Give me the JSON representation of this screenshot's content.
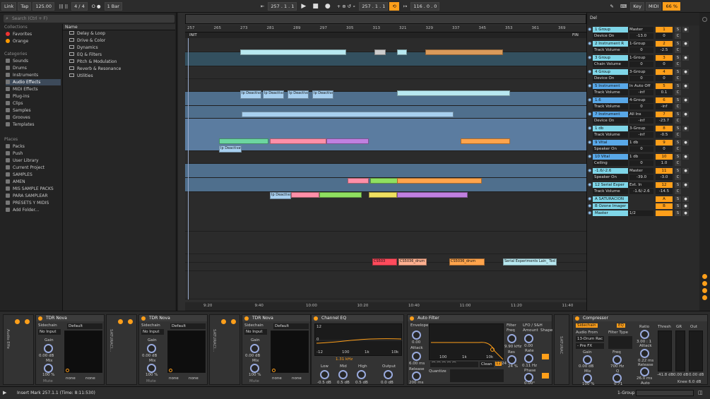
{
  "topbar": {
    "link": "Link",
    "tap": "Tap",
    "tempo": "125.00",
    "time_sig": "4 / 4",
    "metro": "O ●",
    "quant": "1 Bar",
    "pos": "257 . 1 . 1",
    "pos2": "257 . 1 . 1",
    "loop_len": "116 . 0 . 0",
    "key": "Key",
    "midi": "MIDI",
    "cpu": "66 %"
  },
  "browser": {
    "search_placeholder": "Search (Ctrl + F)",
    "collections_title": "Collections",
    "collections": [
      "Favorites",
      "Orange"
    ],
    "categories_title": "Categories",
    "categories": [
      "Sounds",
      "Drums",
      "Instruments",
      "Audio Effects",
      "MIDI Effects",
      "Plug-ins",
      "Clips",
      "Samples",
      "Grooves",
      "Templates"
    ],
    "places_title": "Places",
    "places": [
      "Packs",
      "Push",
      "User Library",
      "Current Project",
      "SAMPLES",
      "AMEN",
      "MIS SAMPLE PACKS",
      "PARA SAMPLEAR",
      "PRESETS Y MIDIS",
      "Add Folder..."
    ],
    "name_header": "Name",
    "files": [
      "Delay & Loop",
      "Drive & Color",
      "Dynamics",
      "EQ & Filters",
      "Pitch & Modulation",
      "Reverb & Resonance",
      "Utilities"
    ]
  },
  "arrangement": {
    "bars": [
      "257",
      "265",
      "273",
      "281",
      "289",
      "297",
      "305",
      "313",
      "321",
      "329",
      "337",
      "345",
      "353",
      "361",
      "369"
    ],
    "init": "INIT",
    "fin": "FIN",
    "times": [
      "9:20",
      "9:40",
      "10:00",
      "10:20",
      "10:40",
      "11:00",
      "11:20",
      "11:40"
    ],
    "clip_deact": "Ip Deactivat",
    "clip_cs": "CS5036_drum",
    "clip_serial": "Serial Experiments Lain_ Tod"
  },
  "mixer": {
    "header": "Del",
    "tracks": [
      {
        "name": "1 Group",
        "route": "Master",
        "num": "1",
        "vol": "0",
        "color": "#7fd6e8",
        "sub": "Device On",
        "subval": "-13.0"
      },
      {
        "name": "2 Instrument R",
        "route": "1-Group",
        "num": "2",
        "vol": "-2.5",
        "color": "#7fd6e8",
        "sub": "Track Volume",
        "subval": "0"
      },
      {
        "name": "3 Group",
        "route": "1-Group",
        "num": "3",
        "vol": "0",
        "color": "#7fd6e8",
        "sub": "Chain Volume",
        "subval": "0"
      },
      {
        "name": "4 Group",
        "route": "3-Group",
        "num": "4",
        "vol": "0",
        "color": "#7fd6e8",
        "sub": "Device On",
        "subval": "0"
      },
      {
        "name": "5 Instrument",
        "route": "In Auto Off",
        "num": "5",
        "vol": "0.1",
        "color": "#59a8e8",
        "sub": "Track Volume",
        "subval": "-inf"
      },
      {
        "name": "1.6",
        "route": "4-Group",
        "num": "6",
        "vol": "-inf",
        "color": "#59a8e8",
        "sub": "Track Volume",
        "subval": "0"
      },
      {
        "name": "7 Instrument",
        "route": "All Ins",
        "num": "7",
        "vol": "-23.7",
        "color": "#59a8e8",
        "sub": "Device On",
        "subval": "-inf"
      },
      {
        "name": "1 db",
        "route": "3-Group",
        "num": "8",
        "vol": "-0.5",
        "color": "#7fd6e8",
        "sub": "Track Volume",
        "subval": "-inf"
      },
      {
        "name": "9 Vital",
        "route": "1 db",
        "num": "9",
        "vol": "0",
        "color": "#59a8e8",
        "sub": "Speaker On",
        "subval": "0"
      },
      {
        "name": "10 Vital",
        "route": "1 db",
        "num": "10",
        "vol": "1.0",
        "color": "#59a8e8",
        "sub": "Ceiling",
        "subval": "0"
      },
      {
        "name": "-1.6/-2.6",
        "route": "Master",
        "num": "11",
        "vol": "-3.0",
        "color": "#7fd6e8",
        "sub": "Speaker On",
        "subval": "-39.0"
      },
      {
        "name": "12 Serial Exper",
        "route": "Ext. In",
        "num": "12",
        "vol": "-14.5",
        "color": "#7fd6e8",
        "sub": "Track Volume",
        "subval": "-1.6/-2.6"
      },
      {
        "name": "A SATURACION",
        "route": "",
        "num": "A",
        "vol": "0",
        "color": "#7fd6e8",
        "sub": "",
        "subval": ""
      },
      {
        "name": "B Ozone Imager",
        "route": "",
        "num": "B",
        "vol": "0",
        "color": "#7fd6e8",
        "sub": "",
        "subval": ""
      },
      {
        "name": "Master",
        "route": "1/2",
        "num": "",
        "vol": "0",
        "color": "#7fd6e8",
        "sub": "",
        "subval": ""
      }
    ],
    "solo": "S",
    "cue": "C"
  },
  "devices": {
    "tdr": [
      {
        "title": "TDR Nova",
        "sidechain": "Sidechain",
        "input": "No Input",
        "preset": "Default",
        "gain": "Gain",
        "gain_val": "0.00 dB",
        "mix": "Mix",
        "mix_val": "100 %",
        "mute": "Mute",
        "none1": "none",
        "none2": "none",
        "side": "Audio Effe"
      },
      {
        "title": "TDR Nova",
        "sidechain": "Sidechain",
        "input": "No Input",
        "preset": "Default",
        "gain": "Gain",
        "gain_val": "0.00 dB",
        "mix": "Mix",
        "mix_val": "100 %",
        "mute": "Mute",
        "none1": "none",
        "none2": "none",
        "side": "SATURACI..."
      },
      {
        "title": "TDR Nova",
        "sidechain": "Sidechain",
        "input": "No Input",
        "preset": "Default",
        "gain": "Gain",
        "gain_val": "0.00 dB",
        "mix": "Mix",
        "mix_val": "100 %",
        "mute": "Mute",
        "none1": "none",
        "none2": "none",
        "side": "SATURACI..."
      }
    ],
    "eq": {
      "title": "Channel EQ",
      "db12": "12",
      "db0": "0",
      "dbm12": "-12",
      "f100": "100",
      "f1k": "1k",
      "f10k": "10k",
      "freq": "1.31 kHz",
      "low": "Low",
      "mid": "Mid",
      "high": "High",
      "output": "Output",
      "low_val": "-0.5 dB",
      "mid_val": "0.5 dB",
      "high_val": "0.5 dB",
      "out_val": "0.0 dB"
    },
    "autofilter": {
      "title": "Auto Filter",
      "envelope": "Envelope",
      "attack": "Attack",
      "release": "Release",
      "att_val": "6.00 ms",
      "rel_val": "200 ms",
      "zero": "0.00",
      "filter": "Filter",
      "freq": "Freq",
      "freq_val": "9.90 kHz",
      "res": "Res",
      "res_val": "24 %",
      "lfo": "LFO / S&H",
      "amount": "Amount",
      "rate": "Rate",
      "shape": "Shape",
      "phase": "Phase",
      "amt_val": "0.00",
      "rate_val": "0.11 Hz",
      "phase_val": "0.00°",
      "clean": "Clean",
      "n12": "12",
      "n24": "24",
      "quantize": "Quantize",
      "f100": "100",
      "f1k": "1k",
      "f10k": "10k"
    },
    "comp": {
      "title": "Compressor",
      "sidechain": "Sidechain",
      "eq": "EQ",
      "audio_from": "Audio From",
      "audio_from_val": "13-Drum Rac",
      "pre": "- Pre FX",
      "filter_type": "Filter Type",
      "gain": "Gain",
      "freq": "Freq",
      "q": "Q",
      "mix": "Mix",
      "gain_val": "0.00 dB",
      "freq_val": "700 Hz",
      "q_val": "0.71",
      "mix_val": "100 %",
      "ratio": "Ratio",
      "ratio_val": "3.00 : 1",
      "attack": "Attack",
      "att_val": "0.22 ms",
      "release": "Release",
      "rel_val": "26.0 ms",
      "auto": "Auto",
      "thresh": "Thresh",
      "gr": "GR",
      "out": "Out",
      "thresh_val": "-41.8 dB",
      "gr_val": "0.00 dB",
      "out_val": "0.00 dB",
      "knee": "Knee 6.0 dB"
    }
  },
  "status": {
    "message": "Insert Mark 257.1.1 (Time: 8:11:530)",
    "track": "1-Group"
  }
}
